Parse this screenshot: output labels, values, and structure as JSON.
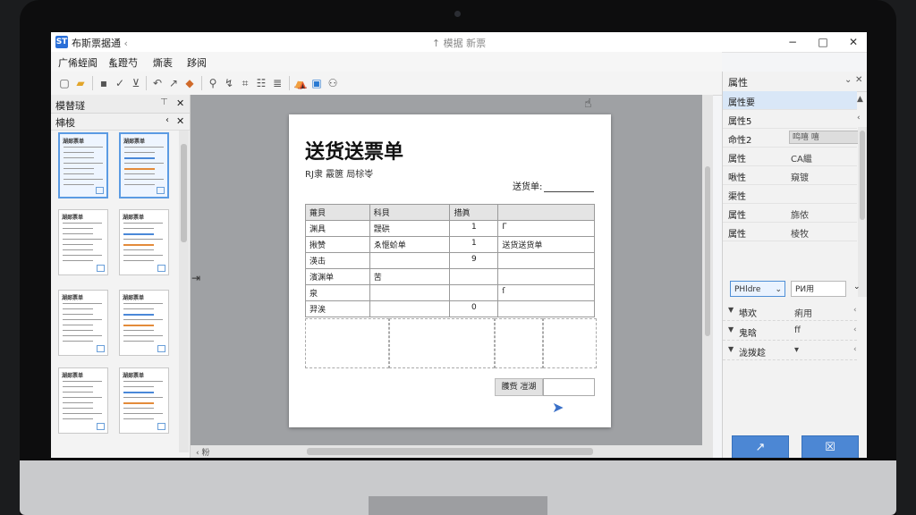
{
  "window": {
    "app_name": "布斯票据通",
    "app_logo": "ST",
    "title": "↑ 模据 新票",
    "title_suffix": "‹",
    "controls": {
      "minimize": "−",
      "maximize": "□",
      "close": "✕"
    }
  },
  "menu": [
    "广俙蛭阍",
    "蚃蹬芍",
    "燍袠",
    "跢阅"
  ],
  "toolbar_icons": [
    "new-file-icon",
    "open-folder-icon",
    "save-icon",
    "check-icon",
    "cross-check-icon",
    "undo-icon",
    "redo-icon",
    "undo-alt-icon",
    "zoom-icon",
    "zoom-out-icon",
    "align-icon",
    "table-icon",
    "grid-icon",
    "print-icon",
    "preview-icon",
    "help-icon"
  ],
  "left_panel": {
    "title": "模替璲",
    "subtitle": "梙梭",
    "head_controls": {
      "pin": "⊤",
      "close": "✕"
    },
    "sub_controls": {
      "scroll": "‹",
      "close": "✕"
    },
    "thumbnails": [
      {
        "title": "湖郯票单",
        "selected": true
      },
      {
        "title": "湖郯票单",
        "selected": true
      },
      {
        "title": "湖郯票单",
        "selected": false
      },
      {
        "title": "湖郯票单",
        "selected": false
      },
      {
        "title": "湖郯票单",
        "selected": false
      },
      {
        "title": "湖郯票单",
        "selected": false
      },
      {
        "title": "湖郯票单",
        "selected": false
      },
      {
        "title": "湖郯票单",
        "selected": false
      }
    ],
    "page_label": "‹ 粉"
  },
  "document": {
    "title": "送货送票单",
    "subtitle": "RJ隶 霰篋 局梌岺",
    "number_label": "送货单:",
    "table": {
      "headers": [
        "蕹貝",
        "科貝",
        "措眞",
        ""
      ],
      "rows": [
        [
          "渊具",
          "靉硔",
          "1",
          "Г"
        ],
        [
          "揪赞",
          "ゑ愜蚧单",
          "1",
          "送货送货单"
        ],
        [
          "渶击",
          "",
          "9",
          ""
        ],
        [
          "濱渊单",
          "苦",
          "",
          ""
        ],
        [
          "泉",
          "",
          "",
          "ſ"
        ],
        [
          "羿涘",
          "",
          "0",
          ""
        ]
      ]
    },
    "total_label": "臒赀 凒湖"
  },
  "right_panel": {
    "title": "属性",
    "controls": {
      "dropdown": "⌄",
      "close": "✕"
    },
    "properties": [
      {
        "key": "属性要",
        "value": "",
        "highlight": true,
        "marker": "▲"
      },
      {
        "key": "属性5",
        "value": "",
        "highlight": false,
        "marker": "‹"
      },
      {
        "key": "命性2",
        "value": "鸣嘻 嘻",
        "box": true,
        "marker": "⌄"
      },
      {
        "key": "属性",
        "value": "CA繼",
        "highlight": false
      },
      {
        "key": "啾性",
        "value": "窺镀",
        "highlight": false
      },
      {
        "key": "渠性",
        "value": "",
        "highlight": false
      },
      {
        "key": "属性",
        "value": "旆侬",
        "highlight": false
      },
      {
        "key": "属性",
        "value": "棱牧",
        "highlight": false,
        "marker": "⌄"
      }
    ],
    "combo1": "PHldre",
    "combo1_arrow": "⌄",
    "combo2": "РИ用",
    "combo2_arrow": "⌄",
    "tree": [
      {
        "key": "塨欢",
        "value": "痢用",
        "marker": "‹"
      },
      {
        "key": "鬼晗",
        "value": "ff",
        "marker": "‹"
      },
      {
        "key": "泷拨趁",
        "value": "▾",
        "marker": "‹"
      }
    ],
    "buttons": {
      "apply_icon": "↗",
      "close_icon": "☒"
    }
  }
}
